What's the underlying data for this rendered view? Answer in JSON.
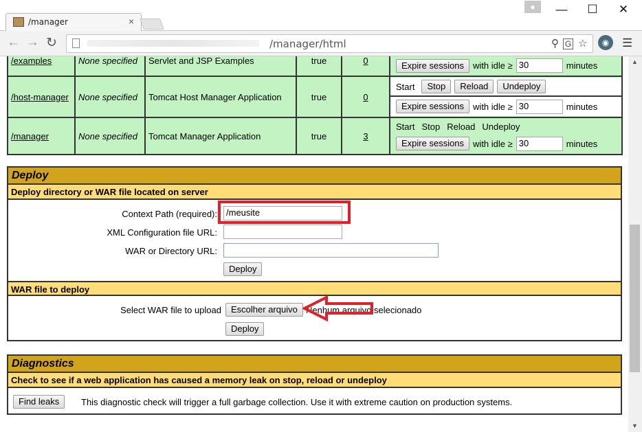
{
  "browser": {
    "tab_title": "/manager",
    "tab_close": "×",
    "url": "/manager/html",
    "window_controls": {
      "minimize": "—",
      "maximize": "☐",
      "close": "✕"
    }
  },
  "apps": [
    {
      "path": "/examples",
      "version": "None specified",
      "display_name": "Servlet and JSP Examples",
      "running": "true",
      "sessions": "0",
      "commands": [],
      "expire_label": "Expire sessions",
      "with_idle": "with idle ≥",
      "idle_value": "30",
      "minutes": "minutes"
    },
    {
      "path": "/host-manager",
      "version": "None specified",
      "display_name": "Tomcat Host Manager Application",
      "running": "true",
      "sessions": "0",
      "commands": [
        "Start",
        "Stop",
        "Reload",
        "Undeploy"
      ],
      "expire_label": "Expire sessions",
      "with_idle": "with idle ≥",
      "idle_value": "30",
      "minutes": "minutes"
    },
    {
      "path": "/manager",
      "version": "None specified",
      "display_name": "Tomcat Manager Application",
      "running": "true",
      "sessions": "3",
      "commands": [
        "Start",
        "Stop",
        "Reload",
        "Undeploy"
      ],
      "expire_label": "Expire sessions",
      "with_idle": "with idle ≥",
      "idle_value": "30",
      "minutes": "minutes"
    }
  ],
  "deploy": {
    "title": "Deploy",
    "server_subtitle": "Deploy directory or WAR file located on server",
    "context_path_label": "Context Path (required):",
    "context_path_value": "/meusite",
    "xml_config_label": "XML Configuration file URL:",
    "xml_config_value": "",
    "war_dir_label": "WAR or Directory URL:",
    "war_dir_value": "",
    "deploy_button": "Deploy",
    "war_subtitle": "WAR file to deploy",
    "select_war_label": "Select WAR file to upload",
    "choose_file_button": "Escolher arquivo",
    "no_file_text": "Nenhum arquivo selecionado",
    "upload_deploy_button": "Deploy"
  },
  "diagnostics": {
    "title": "Diagnostics",
    "subtitle": "Check to see if a web application has caused a memory leak on stop, reload or undeploy",
    "find_leaks_button": "Find leaks",
    "description": "This diagnostic check will trigger a full garbage collection. Use it with extreme caution on production systems."
  },
  "colors": {
    "row_green": "#c3f3c3",
    "section_header": "#d2a41c",
    "subsection_header": "#ffdc75",
    "annotation_red": "#e0202a"
  }
}
